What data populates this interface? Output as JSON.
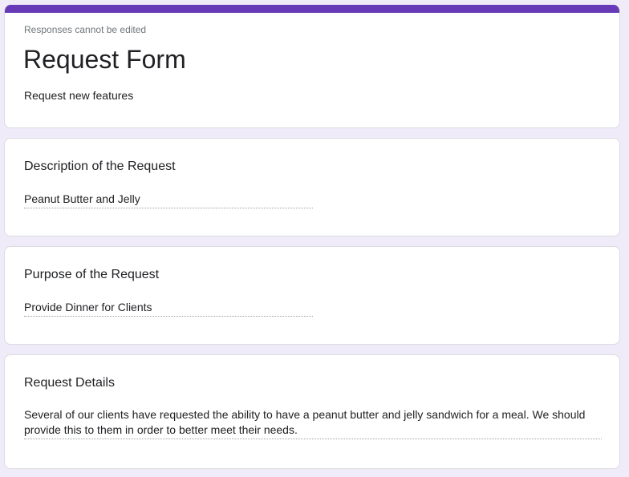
{
  "header": {
    "notice": "Responses cannot be edited",
    "title": "Request Form",
    "description": "Request new features"
  },
  "questions": [
    {
      "title": "Description of the Request",
      "answer": "Peanut Butter and Jelly"
    },
    {
      "title": "Purpose of the Request",
      "answer": "Provide Dinner for Clients"
    },
    {
      "title": "Request Details",
      "answer": "Several of our clients have requested the ability to have a peanut butter and jelly sandwich for a meal. We should provide this to them in order to better meet their needs."
    }
  ],
  "colors": {
    "accent": "#673ab7",
    "background": "#f0ebf8"
  }
}
